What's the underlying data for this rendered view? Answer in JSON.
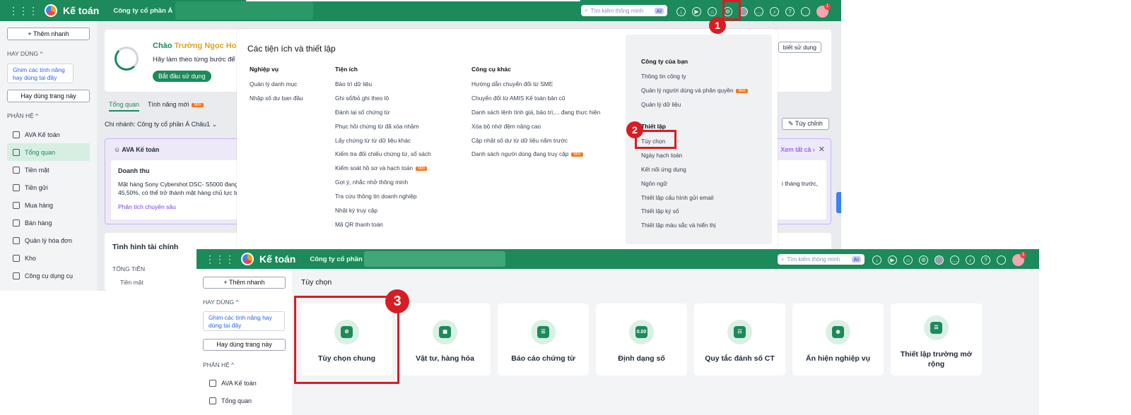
{
  "back": {
    "app_name": "Kế toán",
    "company": "Công ty cổ phần Á",
    "search_placeholder": "Tìm kiếm thông minh",
    "ai": "AI",
    "add_quick": "Thêm nhanh",
    "hay_dung": "HAY DÙNG",
    "pin_text": "Ghim các tính năng hay dùng tại đây",
    "hay_dung_page": "Hay dùng trang này",
    "phan_he": "PHÂN HỆ",
    "nav": [
      "AVA Kế toán",
      "Tổng quan",
      "Tiền mặt",
      "Tiền gửi",
      "Mua hàng",
      "Bán hàng",
      "Quản lý hóa đơn",
      "Kho",
      "Công cụ dụng cụ"
    ],
    "greeting": "Chào",
    "user_name": "Trường Ngọc Hoa,",
    "greeting_sub": "Hãy làm theo từng bước để",
    "start_btn": "Bắt đầu sử dụng",
    "tabs": [
      "Tổng quan",
      "Tính năng mới"
    ],
    "new_badge": "Mới",
    "branch": "Chi nhánh: Công ty cổ phần Á Châu1",
    "ava_title": "AVA Kế toán",
    "revenue_title": "Doanh thu",
    "revenue_text": "Mặt hàng Sony Cybershot DSC- S5000 đang 45,50%, có thể trở thành mặt hàng chủ lực tr",
    "analysis_link": "Phân tích chuyên sâu",
    "finance": "Tình hình tài chính",
    "total_assets": "TỔNG TIỀN",
    "cash": "Tiền mặt",
    "guide": "biết sử dụng",
    "customize": "Tùy chỉnh",
    "view_all": "Xem tất cả",
    "right_text": "i tháng trước,",
    "notif_count": "1"
  },
  "popup": {
    "title": "Các tiện ích và thiết lập",
    "col1": {
      "title": "Nghiệp vụ",
      "items": [
        "Quản lý danh mục",
        "Nhập số dư ban đầu"
      ]
    },
    "col2": {
      "title": "Tiện ích",
      "items": [
        "Bảo trì dữ liệu",
        "Ghi sổ/bỏ ghi theo lô",
        "Đánh lại số chứng từ",
        "Phục hồi chứng từ đã xóa nhầm",
        "Lấy chứng từ từ dữ liệu khác",
        "Kiểm tra đối chiếu chứng từ, sổ sách",
        "Kiểm soát hồ sơ và hạch toán",
        "Gợi ý, nhắc nhở thông minh",
        "Tra cứu thông tin doanh nghiệp",
        "Nhật ký truy cập",
        "Mã QR thanh toán"
      ]
    },
    "col3": {
      "title": "Công cụ khác",
      "items": [
        "Hướng dẫn chuyển đổi từ SME",
        "Chuyển đổi từ AMIS Kế toán bản cũ",
        "Danh sách lệnh tính giá, bảo trì,... đang thực hiện",
        "Xóa bộ nhớ đệm nâng cao",
        "Cập nhật số dư từ dữ liệu năm trước",
        "Danh sách người dùng đang truy cập"
      ]
    },
    "company_title": "Công ty của bạn",
    "company_items": [
      "Thông tin công ty",
      "Quản lý người dùng và phân quyền",
      "Quản lý dữ liệu"
    ],
    "settings_title": "Thiết lập",
    "settings_items": [
      "Tùy chọn",
      "Ngày hạch toán",
      "Kết nối ứng dụng",
      "Ngôn ngữ",
      "Thiết lập cấu hình gửi email",
      "Thiết lập ký số",
      "Thiết lập màu sắc và hiển thị"
    ],
    "badge": "Mới"
  },
  "steps": [
    "1",
    "2",
    "3"
  ],
  "front": {
    "app_name": "Kế toán",
    "company": "Công ty cổ phần",
    "search_placeholder": "Tìm kiếm thông minh",
    "ai": "AI",
    "add_quick": "Thêm nhanh",
    "hay_dung": "HAY DÙNG",
    "pin_text": "Ghim các tính năng hay dùng tại đây",
    "hay_dung_page": "Hay dùng trang này",
    "phan_he": "PHÂN HỆ",
    "nav": [
      "AVA Kế toán",
      "Tổng quan"
    ],
    "page_title": "Tùy chọn",
    "cards": [
      "Tùy chọn chung",
      "Vật tư, hàng hóa",
      "Báo cáo chứng từ",
      "Định dạng số",
      "Quy tắc đánh số CT",
      "Ẩn hiện nghiệp vụ",
      "Thiết lập trường mở rộng"
    ],
    "number_icon_text": "0.00",
    "notif_count": "1"
  },
  "colors": {
    "brand": "#1c8a5b",
    "highlight": "#d91c24",
    "badge": "#f97316"
  }
}
